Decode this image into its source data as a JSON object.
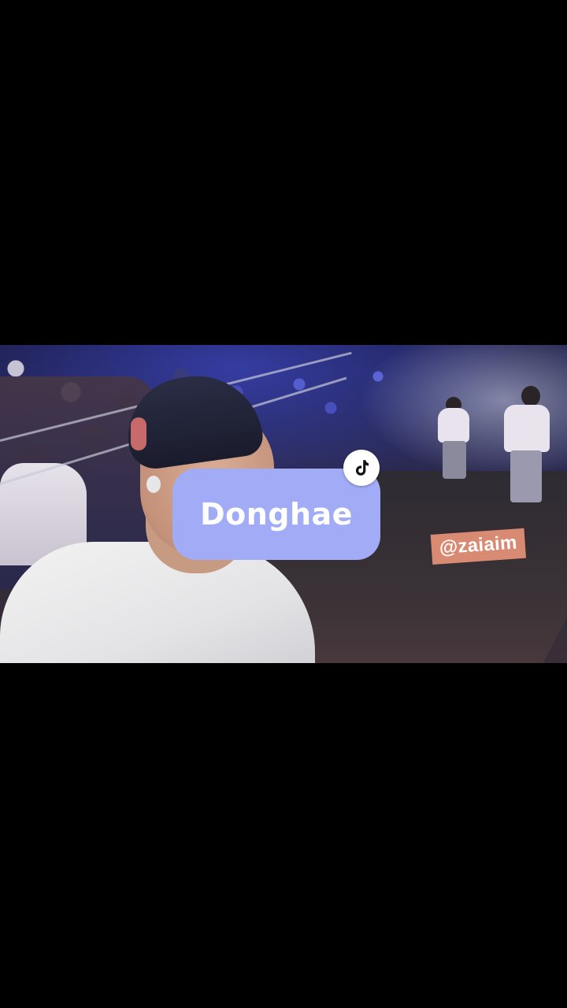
{
  "overlay": {
    "name_label": "Donghae",
    "handle": "@zaiaim"
  },
  "icons": {
    "app_badge": "tiktok-note-icon"
  },
  "colors": {
    "pill_bg": "#a2abf5",
    "handle_bg": "#d98a72",
    "letterbox": "#000000"
  }
}
